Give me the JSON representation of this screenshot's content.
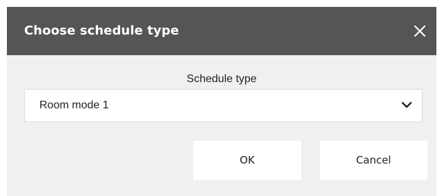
{
  "dialog": {
    "title": "Choose schedule type",
    "close_icon": "close-icon"
  },
  "schedule_type": {
    "label": "Schedule type",
    "selected_value": "Room mode 1",
    "dropdown_icon": "chevron-down-icon"
  },
  "buttons": {
    "ok_label": "OK",
    "cancel_label": "Cancel"
  },
  "colors": {
    "header_background": "#555555",
    "dialog_background": "#f0f0f0",
    "button_background": "#ffffff",
    "text": "#222222"
  }
}
